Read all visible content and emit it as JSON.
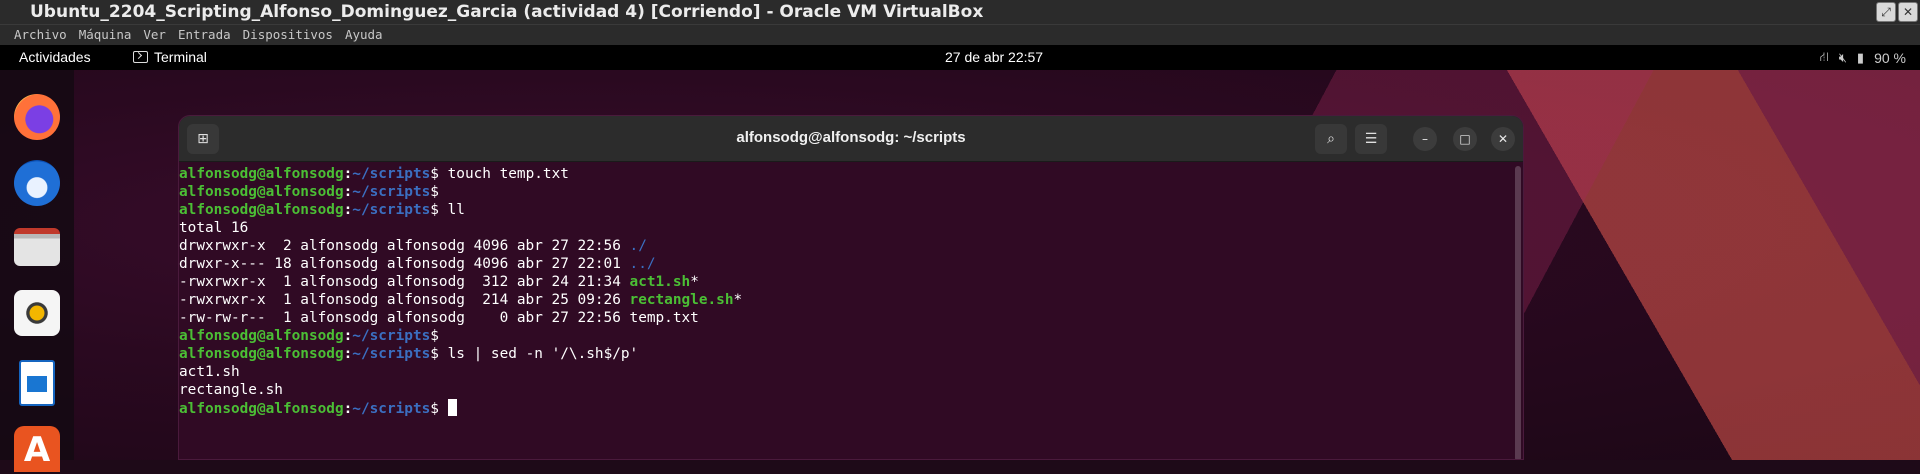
{
  "host_window": {
    "title": "Ubuntu_2204_Scripting_Alfonso_Dominguez_Garcia (actividad 4) [Corriendo] - Oracle VM VirtualBox",
    "controls": [
      "restore",
      "close"
    ]
  },
  "host_menu": [
    "Archivo",
    "Máquina",
    "Ver",
    "Entrada",
    "Dispositivos",
    "Ayuda"
  ],
  "topbar": {
    "activities": "Actividades",
    "app_name": "Terminal",
    "clock": "27 de abr  22:57",
    "battery": "90 %",
    "icons": [
      "network-icon",
      "volume-muted-icon",
      "battery-icon"
    ]
  },
  "dock": {
    "apps": [
      "firefox",
      "thunderbird",
      "files",
      "rhythmbox",
      "libreoffice-writer",
      "app-center"
    ],
    "appcenter_glyph": "A"
  },
  "terminal": {
    "title": "alfonsodg@alfonsodg: ~/scripts",
    "prompt": {
      "user": "alfonsodg@alfonsodg",
      "colon": ":",
      "path": "~/scripts",
      "dollar": "$"
    },
    "lines": [
      {
        "type": "prompt",
        "cmd": " touch temp.txt"
      },
      {
        "type": "prompt",
        "cmd": ""
      },
      {
        "type": "prompt",
        "cmd": " ll"
      },
      {
        "type": "out",
        "text": "total 16"
      },
      {
        "type": "ls",
        "text": "drwxrwxr-x  2 alfonsodg alfonsodg 4096 abr 27 22:56 ",
        "name": "./",
        "kind": "dir",
        "suffix": ""
      },
      {
        "type": "ls",
        "text": "drwxr-x--- 18 alfonsodg alfonsodg 4096 abr 27 22:01 ",
        "name": "../",
        "kind": "dir",
        "suffix": ""
      },
      {
        "type": "ls",
        "text": "-rwxrwxr-x  1 alfonsodg alfonsodg  312 abr 24 21:34 ",
        "name": "act1.sh",
        "kind": "exec",
        "suffix": "*"
      },
      {
        "type": "ls",
        "text": "-rwxrwxr-x  1 alfonsodg alfonsodg  214 abr 25 09:26 ",
        "name": "rectangle.sh",
        "kind": "exec",
        "suffix": "*"
      },
      {
        "type": "ls",
        "text": "-rw-rw-r--  1 alfonsodg alfonsodg    0 abr 27 22:56 ",
        "name": "temp.txt",
        "kind": "plain",
        "suffix": ""
      },
      {
        "type": "prompt",
        "cmd": ""
      },
      {
        "type": "prompt",
        "cmd": " ls | sed -n '/\\.sh$/p'"
      },
      {
        "type": "out",
        "text": "act1.sh"
      },
      {
        "type": "out",
        "text": "rectangle.sh"
      },
      {
        "type": "prompt",
        "cmd": " ",
        "cursor": true
      }
    ]
  }
}
